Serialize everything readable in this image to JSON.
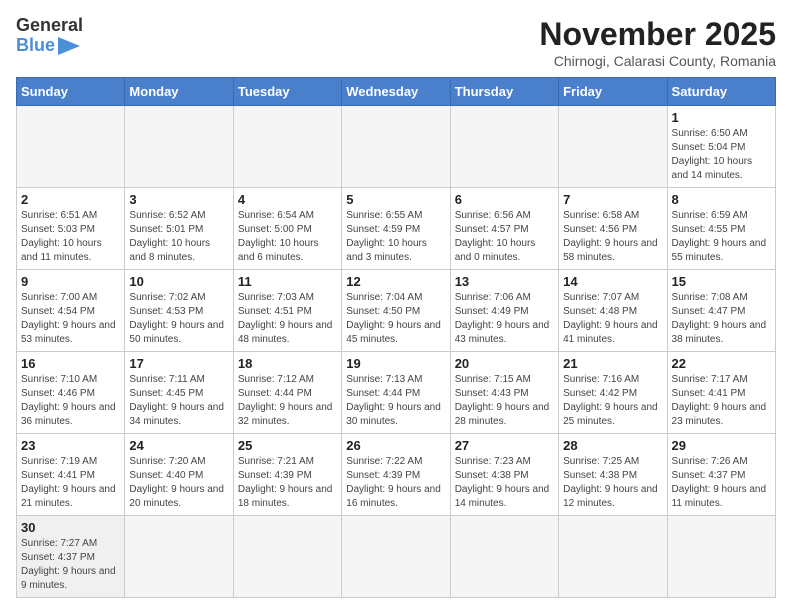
{
  "header": {
    "logo": {
      "text_general": "General",
      "text_blue": "Blue"
    },
    "title": "November 2025",
    "location": "Chirnogi, Calarasi County, Romania"
  },
  "weekdays": [
    "Sunday",
    "Monday",
    "Tuesday",
    "Wednesday",
    "Thursday",
    "Friday",
    "Saturday"
  ],
  "weeks": [
    [
      {
        "day": "",
        "info": ""
      },
      {
        "day": "",
        "info": ""
      },
      {
        "day": "",
        "info": ""
      },
      {
        "day": "",
        "info": ""
      },
      {
        "day": "",
        "info": ""
      },
      {
        "day": "",
        "info": ""
      },
      {
        "day": "1",
        "info": "Sunrise: 6:50 AM\nSunset: 5:04 PM\nDaylight: 10 hours and 14 minutes."
      }
    ],
    [
      {
        "day": "2",
        "info": "Sunrise: 6:51 AM\nSunset: 5:03 PM\nDaylight: 10 hours and 11 minutes."
      },
      {
        "day": "3",
        "info": "Sunrise: 6:52 AM\nSunset: 5:01 PM\nDaylight: 10 hours and 8 minutes."
      },
      {
        "day": "4",
        "info": "Sunrise: 6:54 AM\nSunset: 5:00 PM\nDaylight: 10 hours and 6 minutes."
      },
      {
        "day": "5",
        "info": "Sunrise: 6:55 AM\nSunset: 4:59 PM\nDaylight: 10 hours and 3 minutes."
      },
      {
        "day": "6",
        "info": "Sunrise: 6:56 AM\nSunset: 4:57 PM\nDaylight: 10 hours and 0 minutes."
      },
      {
        "day": "7",
        "info": "Sunrise: 6:58 AM\nSunset: 4:56 PM\nDaylight: 9 hours and 58 minutes."
      },
      {
        "day": "8",
        "info": "Sunrise: 6:59 AM\nSunset: 4:55 PM\nDaylight: 9 hours and 55 minutes."
      }
    ],
    [
      {
        "day": "9",
        "info": "Sunrise: 7:00 AM\nSunset: 4:54 PM\nDaylight: 9 hours and 53 minutes."
      },
      {
        "day": "10",
        "info": "Sunrise: 7:02 AM\nSunset: 4:53 PM\nDaylight: 9 hours and 50 minutes."
      },
      {
        "day": "11",
        "info": "Sunrise: 7:03 AM\nSunset: 4:51 PM\nDaylight: 9 hours and 48 minutes."
      },
      {
        "day": "12",
        "info": "Sunrise: 7:04 AM\nSunset: 4:50 PM\nDaylight: 9 hours and 45 minutes."
      },
      {
        "day": "13",
        "info": "Sunrise: 7:06 AM\nSunset: 4:49 PM\nDaylight: 9 hours and 43 minutes."
      },
      {
        "day": "14",
        "info": "Sunrise: 7:07 AM\nSunset: 4:48 PM\nDaylight: 9 hours and 41 minutes."
      },
      {
        "day": "15",
        "info": "Sunrise: 7:08 AM\nSunset: 4:47 PM\nDaylight: 9 hours and 38 minutes."
      }
    ],
    [
      {
        "day": "16",
        "info": "Sunrise: 7:10 AM\nSunset: 4:46 PM\nDaylight: 9 hours and 36 minutes."
      },
      {
        "day": "17",
        "info": "Sunrise: 7:11 AM\nSunset: 4:45 PM\nDaylight: 9 hours and 34 minutes."
      },
      {
        "day": "18",
        "info": "Sunrise: 7:12 AM\nSunset: 4:44 PM\nDaylight: 9 hours and 32 minutes."
      },
      {
        "day": "19",
        "info": "Sunrise: 7:13 AM\nSunset: 4:44 PM\nDaylight: 9 hours and 30 minutes."
      },
      {
        "day": "20",
        "info": "Sunrise: 7:15 AM\nSunset: 4:43 PM\nDaylight: 9 hours and 28 minutes."
      },
      {
        "day": "21",
        "info": "Sunrise: 7:16 AM\nSunset: 4:42 PM\nDaylight: 9 hours and 25 minutes."
      },
      {
        "day": "22",
        "info": "Sunrise: 7:17 AM\nSunset: 4:41 PM\nDaylight: 9 hours and 23 minutes."
      }
    ],
    [
      {
        "day": "23",
        "info": "Sunrise: 7:19 AM\nSunset: 4:41 PM\nDaylight: 9 hours and 21 minutes."
      },
      {
        "day": "24",
        "info": "Sunrise: 7:20 AM\nSunset: 4:40 PM\nDaylight: 9 hours and 20 minutes."
      },
      {
        "day": "25",
        "info": "Sunrise: 7:21 AM\nSunset: 4:39 PM\nDaylight: 9 hours and 18 minutes."
      },
      {
        "day": "26",
        "info": "Sunrise: 7:22 AM\nSunset: 4:39 PM\nDaylight: 9 hours and 16 minutes."
      },
      {
        "day": "27",
        "info": "Sunrise: 7:23 AM\nSunset: 4:38 PM\nDaylight: 9 hours and 14 minutes."
      },
      {
        "day": "28",
        "info": "Sunrise: 7:25 AM\nSunset: 4:38 PM\nDaylight: 9 hours and 12 minutes."
      },
      {
        "day": "29",
        "info": "Sunrise: 7:26 AM\nSunset: 4:37 PM\nDaylight: 9 hours and 11 minutes."
      }
    ],
    [
      {
        "day": "30",
        "info": "Sunrise: 7:27 AM\nSunset: 4:37 PM\nDaylight: 9 hours and 9 minutes."
      },
      {
        "day": "",
        "info": ""
      },
      {
        "day": "",
        "info": ""
      },
      {
        "day": "",
        "info": ""
      },
      {
        "day": "",
        "info": ""
      },
      {
        "day": "",
        "info": ""
      },
      {
        "day": "",
        "info": ""
      }
    ]
  ]
}
